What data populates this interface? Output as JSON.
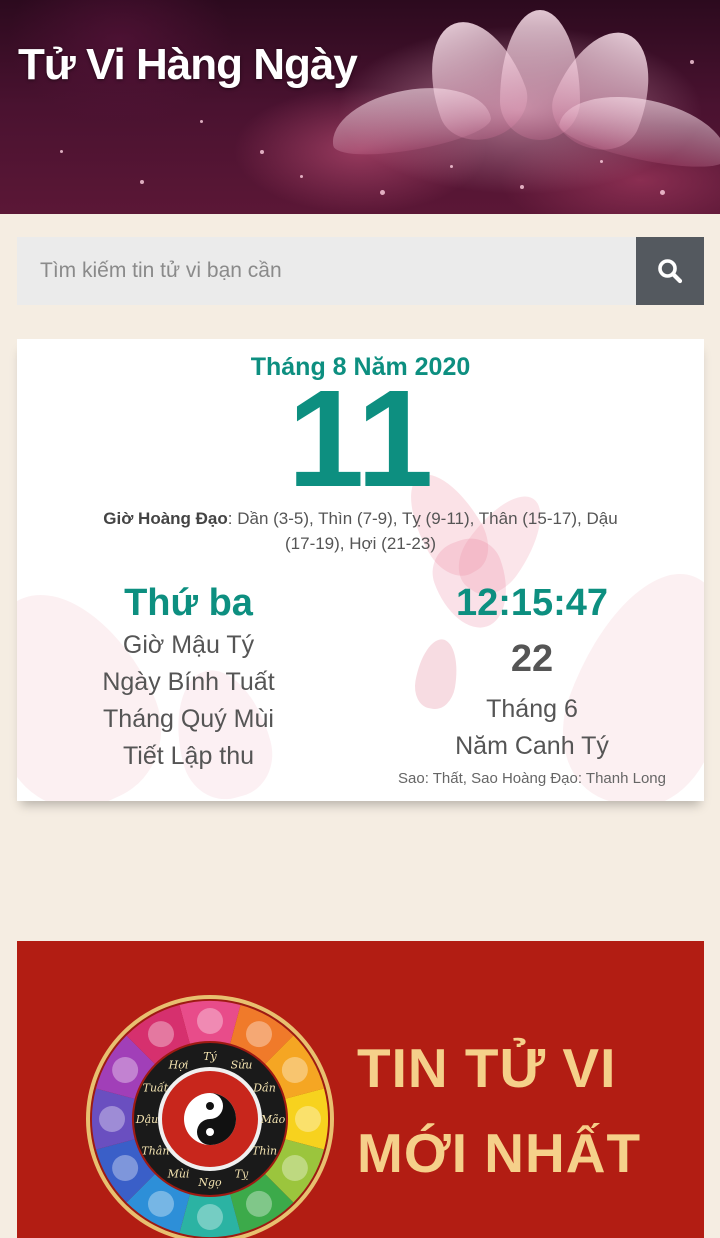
{
  "header": {
    "site_title": "Tử Vi Hàng Ngày"
  },
  "search": {
    "placeholder": "Tìm kiếm tin tử vi bạn cần",
    "button_icon": "search-icon"
  },
  "calendar": {
    "month_year": "Tháng 8 Năm 2020",
    "day": "11",
    "gio_hoang_dao_label": "Giờ Hoàng Đạo",
    "gio_hoang_dao_value": ": Dần (3-5), Thìn (7-9), Tỵ (9-11), Thân (15-17), Dậu (17-19), Hợi (21-23)",
    "left": {
      "weekday": "Thứ ba",
      "gio": "Giờ Mậu Tý",
      "ngay": "Ngày Bính Tuất",
      "thang": "Tháng Quý Mùi",
      "tiet": "Tiết Lập thu"
    },
    "right": {
      "time": "12:15:47",
      "lunar_day": "22",
      "lunar_month": "Tháng 6",
      "lunar_year": "Năm Canh Tý",
      "sao": "Sao: Thất, Sao Hoàng Đạo: Thanh Long"
    }
  },
  "banner": {
    "line1": "TIN TỬ VI",
    "line2": "MỚI NHẤT",
    "wheel_labels": [
      "Tý",
      "Sửu",
      "Dần",
      "Mão",
      "Thìn",
      "Tỵ",
      "Ngọ",
      "Mùi",
      "Thân",
      "Dậu",
      "Tuất",
      "Hợi"
    ]
  },
  "colors": {
    "accent": "#0d8f80",
    "background": "#f5ede2",
    "banner_red": "#b21d13",
    "banner_text": "#f5d08a",
    "search_button": "#54595f"
  }
}
